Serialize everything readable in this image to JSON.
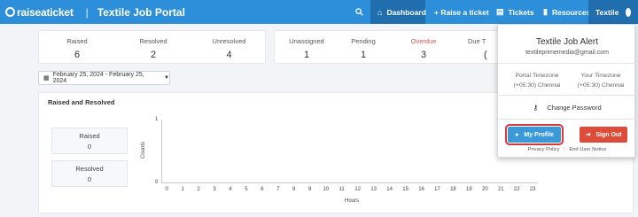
{
  "header": {
    "brand": "raiseaticket",
    "separator": "|",
    "portal_title": "Textile Job Portal",
    "nav": [
      {
        "label": "Dashboard",
        "icon": "home-icon"
      },
      {
        "label": "+ Raise a ticket",
        "icon": ""
      },
      {
        "label": "Tickets",
        "icon": "ticket-icon"
      },
      {
        "label": "Resources",
        "icon": "book-icon"
      },
      {
        "label": "Textile",
        "icon": "avatar-icon"
      }
    ],
    "accent": "#2d8fd9"
  },
  "stats": {
    "group1": [
      {
        "label": "Raised",
        "value": "6"
      },
      {
        "label": "Resolved",
        "value": "2"
      },
      {
        "label": "Unresolved",
        "value": "4"
      }
    ],
    "group2": [
      {
        "label": "Unassigned",
        "value": "1"
      },
      {
        "label": "Pending",
        "value": "1"
      },
      {
        "label": "Overdue",
        "value": "3"
      }
    ],
    "partial": {
      "label": "Due T",
      "value": "("
    }
  },
  "date_filter": {
    "value": "February 25, 2024 - February 25, 2024"
  },
  "panel": {
    "title": "Raised and Resolved",
    "boxes": [
      {
        "label": "Raised",
        "value": "0"
      },
      {
        "label": "Resolved",
        "value": "0"
      }
    ]
  },
  "chart_data": {
    "type": "line",
    "x": [
      0,
      1,
      2,
      3,
      4,
      5,
      6,
      7,
      8,
      9,
      10,
      11,
      12,
      13,
      14,
      15,
      16,
      17,
      18,
      19,
      20,
      21,
      22,
      23
    ],
    "x_tick_labels": [
      "0",
      "1",
      "2",
      "3",
      "4",
      "5",
      "6",
      "7",
      "8",
      "9",
      "10",
      "11",
      "12",
      "13",
      "14",
      "15",
      "16",
      "17",
      "18",
      "19",
      "20",
      "21",
      "22",
      "23"
    ],
    "y_tick_labels": [
      "1",
      "0"
    ],
    "ylim": [
      0,
      1
    ],
    "xlabel": "Hours",
    "ylabel": "Counts"
  },
  "popup": {
    "title": "Textile Job Alert",
    "email": "textileprimemedia@gmail.com",
    "portal_tz_label": "Portal Timezone",
    "portal_tz_value": "(+05:30) Chennai",
    "your_tz_label": "Your Timezone",
    "your_tz_value": "(+05:30) Chennai",
    "change_password": "Change Password",
    "my_profile": "My Profile",
    "sign_out": "Sign Out",
    "privacy": "Privacy Policy",
    "link_sep": "|",
    "end_user": "End User Notice"
  }
}
